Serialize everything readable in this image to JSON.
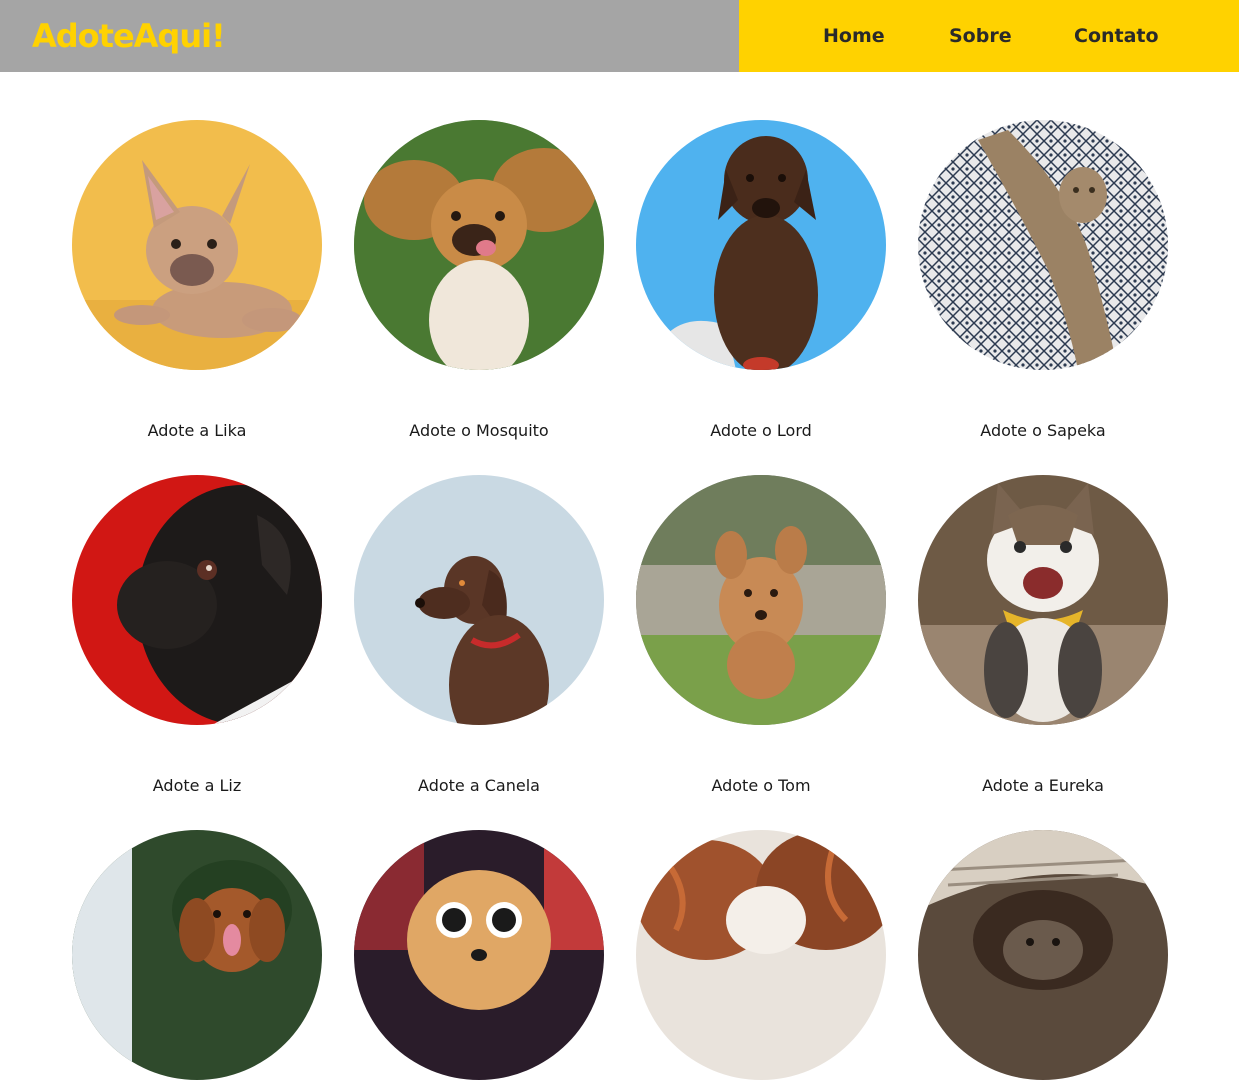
{
  "header": {
    "logo": "AdoteAqui!",
    "nav": [
      {
        "label": "Home"
      },
      {
        "label": "Sobre"
      },
      {
        "label": "Contato"
      }
    ]
  },
  "colors": {
    "header_left_bg": "#a5a5a5",
    "accent_yellow": "#ffd200"
  },
  "pets": [
    {
      "caption": "Adote a Lika",
      "icon": "french-bulldog-photo"
    },
    {
      "caption": "Adote o Mosquito",
      "icon": "cocker-on-grass-photo"
    },
    {
      "caption": "Adote o Lord",
      "icon": "labrador-sky-photo"
    },
    {
      "caption": "Adote o Sapeka",
      "icon": "tabby-cat-photo"
    },
    {
      "caption": "Adote a Liz",
      "icon": "pug-red-photo"
    },
    {
      "caption": "Adote a Canela",
      "icon": "chocolate-lab-photo"
    },
    {
      "caption": "Adote o Tom",
      "icon": "running-poodle-photo"
    },
    {
      "caption": "Adote a Eureka",
      "icon": "happy-cat-photo"
    },
    {
      "caption": "",
      "icon": "retriever-forest-photo"
    },
    {
      "caption": "",
      "icon": "dog-sunglasses-photo"
    },
    {
      "caption": "",
      "icon": "spaniel-sleeping-photo"
    },
    {
      "caption": "",
      "icon": "kitten-blanket-photo"
    }
  ]
}
